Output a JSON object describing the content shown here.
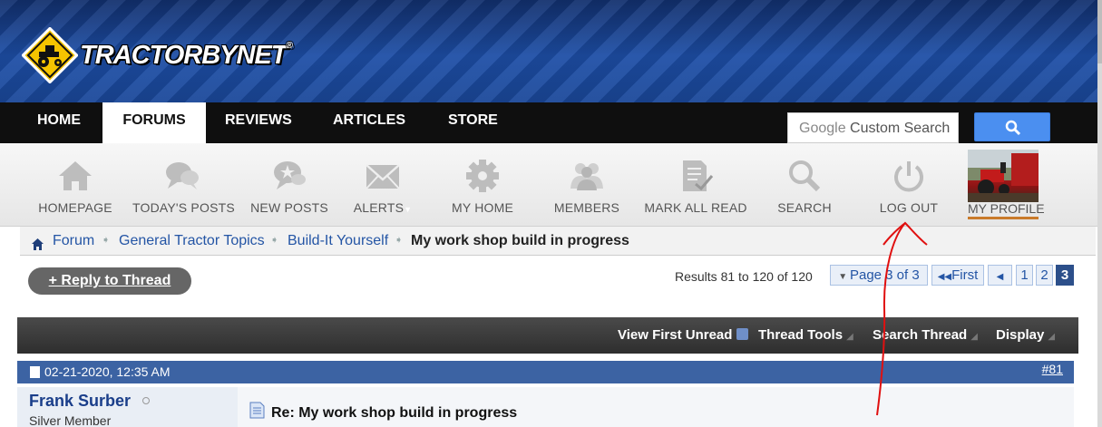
{
  "site": {
    "logo_text": "TRACTORBYNET",
    "trademark": "®"
  },
  "topnav": {
    "tabs": [
      "HOME",
      "FORUMS",
      "REVIEWS",
      "ARTICLES",
      "STORE"
    ],
    "active": "FORUMS",
    "search_placeholder_brand": "Google",
    "search_placeholder_rest": " Custom Search"
  },
  "iconbar": {
    "items": [
      {
        "label": "HOMEPAGE",
        "icon": "house-icon"
      },
      {
        "label": "TODAY'S POSTS",
        "icon": "chat-bubbles-icon"
      },
      {
        "label": "NEW POSTS",
        "icon": "chat-star-icon"
      },
      {
        "label": "ALERTS",
        "icon": "envelope-icon"
      },
      {
        "label": "MY HOME",
        "icon": "gear-icon"
      },
      {
        "label": "MEMBERS",
        "icon": "people-icon"
      },
      {
        "label": "MARK ALL READ",
        "icon": "document-check-icon"
      },
      {
        "label": "SEARCH",
        "icon": "magnifier-icon"
      },
      {
        "label": "LOG OUT",
        "icon": "power-icon"
      }
    ],
    "profile_label": "MY PROFILE"
  },
  "breadcrumb": {
    "items": [
      "Forum",
      "General Tractor Topics",
      "Build-It Yourself"
    ],
    "current": "My work shop build in progress"
  },
  "thread": {
    "reply_label": "+ Reply to Thread",
    "results_text": "Results 81 to 120 of 120",
    "page_selector": "Page 3 of 3",
    "first_label": "First",
    "pages": [
      "1",
      "2",
      "3"
    ],
    "current_page": "3"
  },
  "threadbar": {
    "items": [
      "View First Unread",
      "Thread Tools",
      "Search Thread",
      "Display"
    ]
  },
  "post": {
    "date": "02-21-2020, 12:35 AM",
    "number": "#81",
    "username": "Frank Surber",
    "user_title": "Silver Member",
    "title": "Re: My work shop build in progress"
  },
  "colors": {
    "header_blue": "#1d4ea6",
    "nav_black": "#0f0f0f",
    "link_blue": "#2455a5",
    "post_header": "#3c63a3",
    "annotation_red": "#e01010"
  }
}
